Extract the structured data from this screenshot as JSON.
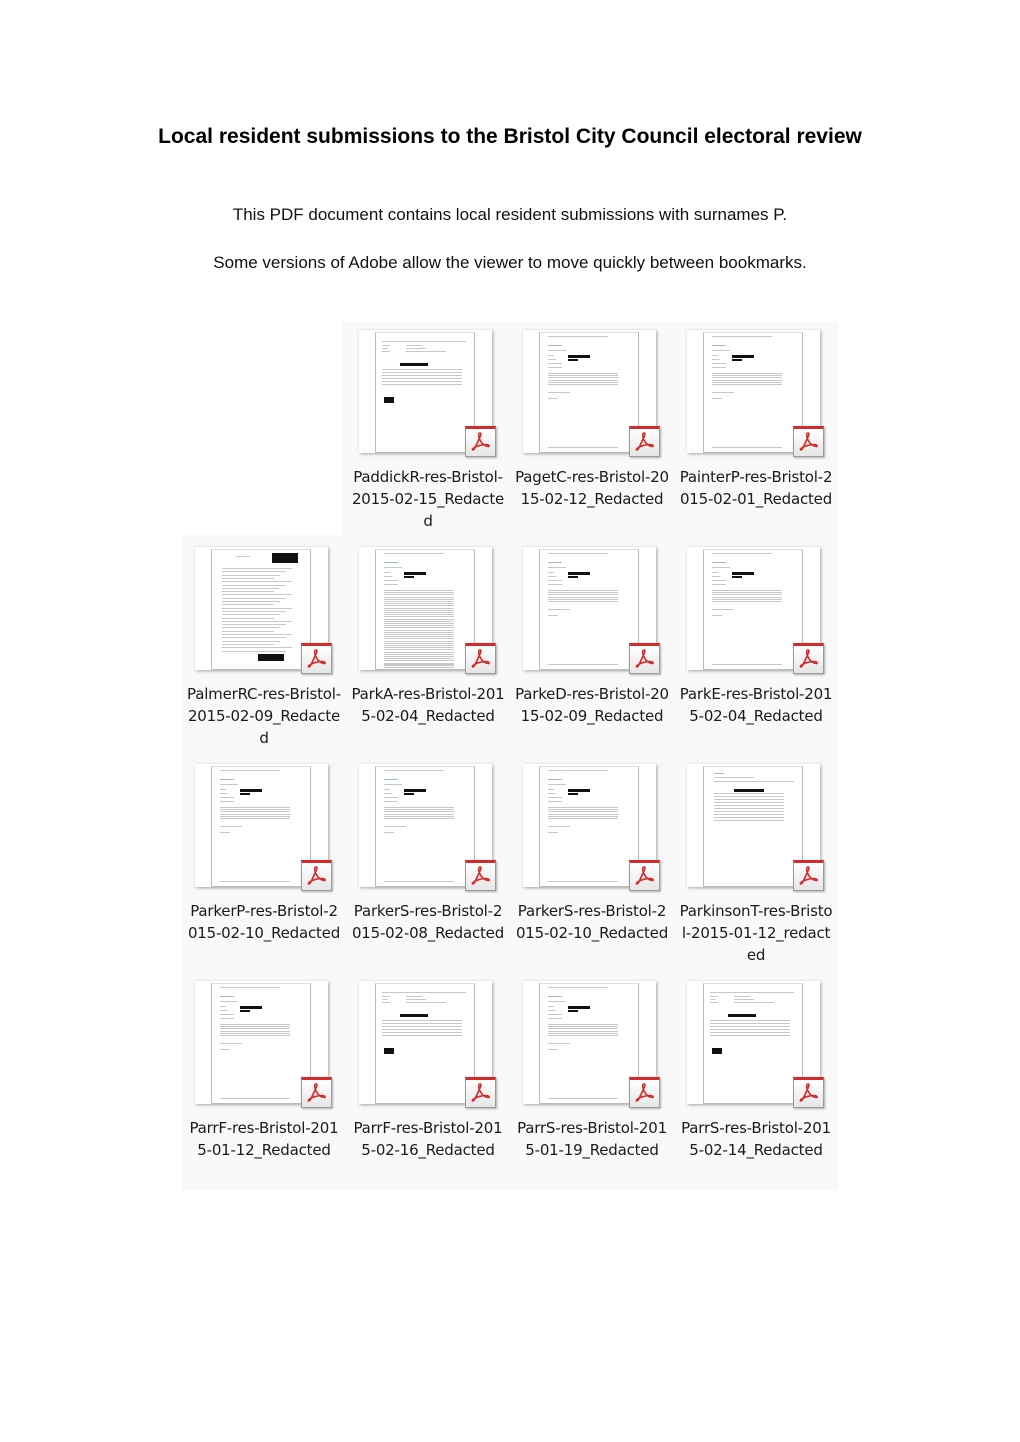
{
  "document": {
    "title": "Local resident submissions to the Bristol City Council electoral review",
    "intro": "This PDF document contains local resident submissions with surnames P.",
    "note": "Some versions of Adobe allow the viewer to move quickly between bookmarks."
  },
  "files": [
    {
      "name": "PaddickR-res-Bristol-2015-02-15_Redacted",
      "icon": "pdf-icon",
      "layout": "email"
    },
    {
      "name": "PagetC-res-Bristol-2015-02-12_Redacted",
      "icon": "pdf-icon",
      "layout": "form"
    },
    {
      "name": "PainterP-res-Bristol-2015-02-01_Redacted",
      "icon": "pdf-icon",
      "layout": "form"
    },
    {
      "name": "PalmerRC-res-Bristol-2015-02-09_Redacted",
      "icon": "pdf-icon",
      "layout": "handwritten"
    },
    {
      "name": "ParkA-res-Bristol-2015-02-04_Redacted",
      "icon": "pdf-icon",
      "layout": "long-form"
    },
    {
      "name": "ParkeD-res-Bristol-2015-02-09_Redacted",
      "icon": "pdf-icon",
      "layout": "form"
    },
    {
      "name": "ParkE-res-Bristol-2015-02-04_Redacted",
      "icon": "pdf-icon",
      "layout": "form"
    },
    {
      "name": "ParkerP-res-Bristol-2015-02-10_Redacted",
      "icon": "pdf-icon",
      "layout": "form"
    },
    {
      "name": "ParkerS-res-Bristol-2015-02-08_Redacted",
      "icon": "pdf-icon",
      "layout": "form"
    },
    {
      "name": "ParkerS-res-Bristol-2015-02-10_Redacted",
      "icon": "pdf-icon",
      "layout": "form"
    },
    {
      "name": "ParkinsonT-res-Bristol-2015-01-12_redacted",
      "icon": "pdf-icon",
      "layout": "letter"
    },
    {
      "name": "ParrF-res-Bristol-2015-01-12_Redacted",
      "icon": "pdf-icon",
      "layout": "form"
    },
    {
      "name": "ParrF-res-Bristol-2015-02-16_Redacted",
      "icon": "pdf-icon",
      "layout": "email"
    },
    {
      "name": "ParrS-res-Bristol-2015-01-19_Redacted",
      "icon": "pdf-icon",
      "layout": "form"
    },
    {
      "name": "ParrS-res-Bristol-2015-02-14_Redacted",
      "icon": "pdf-icon",
      "layout": "email"
    }
  ],
  "colors": {
    "pdf_red": "#d42a2a",
    "grid_background": "#f9f9f9"
  }
}
